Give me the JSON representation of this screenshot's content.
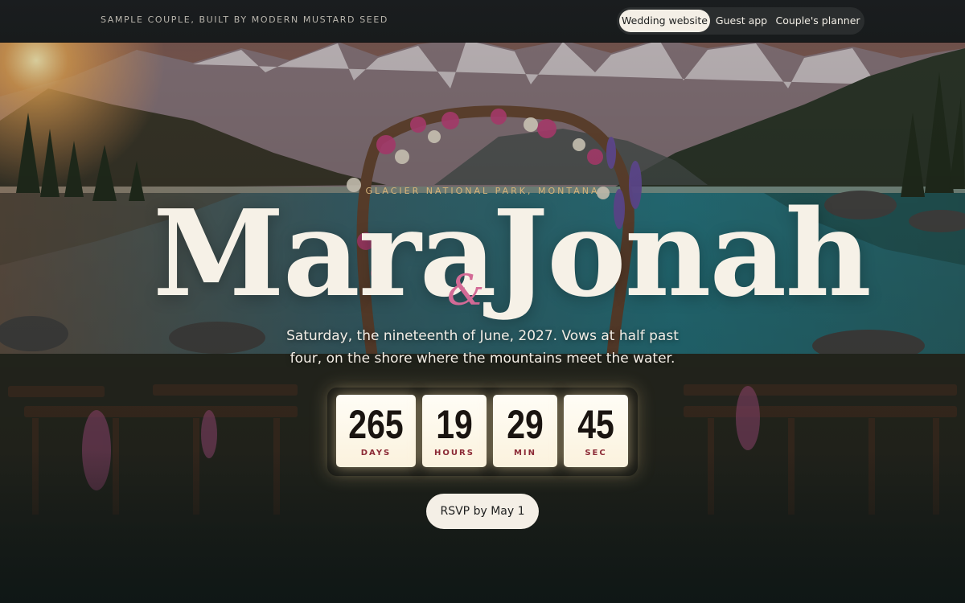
{
  "header": {
    "brand": "SAMPLE COUPLE, BUILT BY MODERN MUSTARD SEED",
    "nav": [
      {
        "label": "Wedding website",
        "active": true
      },
      {
        "label": "Guest app",
        "active": false
      },
      {
        "label": "Couple's planner",
        "active": false
      }
    ]
  },
  "hero": {
    "location": "GLACIER NATIONAL PARK, MONTANA",
    "name_one": "Mara",
    "ampersand": "&",
    "name_two": "Jonah",
    "tagline": "Saturday, the nineteenth of June, 2027. Vows at half past four, on the shore where the mountains meet the water."
  },
  "countdown": [
    {
      "value": "265",
      "unit": "DAYS"
    },
    {
      "value": "19",
      "unit": "HOURS"
    },
    {
      "value": "29",
      "unit": "MIN"
    },
    {
      "value": "45",
      "unit": "SEC"
    }
  ],
  "rsvp": {
    "label": "RSVP by May 1"
  },
  "colors": {
    "accent_gold": "#d6b47a",
    "ampersand_pink": "#d36a96",
    "unit_red": "#8c2a36",
    "cream": "#f4efe6"
  }
}
